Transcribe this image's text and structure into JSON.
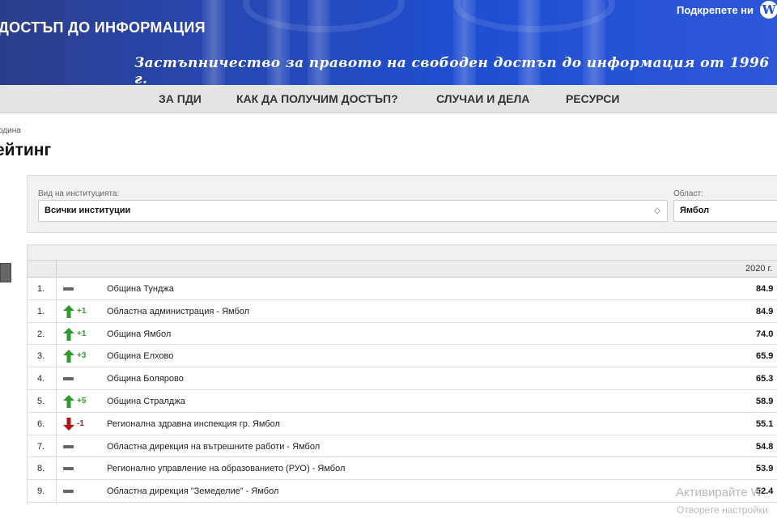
{
  "header": {
    "site_title": "ДОСТЪП ДО ИНФОРМАЦИЯ",
    "tagline": "Застъпничество за правото на свободен достъп до информация от 1996 г.",
    "support_link": "Подкрепете ни",
    "wordpress_icon": "wordpress-icon",
    "wordpress_glyph": "W"
  },
  "nav": {
    "items": [
      {
        "label": "ЗА ПДИ"
      },
      {
        "label": "КАК ДА ПОЛУЧИМ ДОСТЪП?"
      },
      {
        "label": "СЛУЧАИ И ДЕЛА"
      },
      {
        "label": "РЕСУРСИ"
      }
    ]
  },
  "breadcrumb": "одина",
  "page_title": "ейтинг",
  "filters": {
    "institution_type": {
      "label": "Вид на институцията:",
      "value": "Всички институции",
      "chevron": "◇"
    },
    "region": {
      "label": "Област:",
      "value": "Ямбол"
    }
  },
  "table": {
    "year_header": "2020 г.",
    "rows": [
      {
        "rank": "1.",
        "trend": "flat",
        "change": "",
        "name": "Община Тунджа",
        "score": "84.9"
      },
      {
        "rank": "1.",
        "trend": "up",
        "change": "+1",
        "name": "Областна администрация - Ямбол",
        "score": "84.9"
      },
      {
        "rank": "2.",
        "trend": "up",
        "change": "+1",
        "name": "Община Ямбол",
        "score": "74.0"
      },
      {
        "rank": "3.",
        "trend": "up",
        "change": "+3",
        "name": "Община Елхово",
        "score": "65.9"
      },
      {
        "rank": "4.",
        "trend": "flat",
        "change": "",
        "name": "Община Болярово",
        "score": "65.3"
      },
      {
        "rank": "5.",
        "trend": "up",
        "change": "+5",
        "name": "Община Стралджа",
        "score": "58.9"
      },
      {
        "rank": "6.",
        "trend": "down",
        "change": "-1",
        "name": "Регионална здравна инспекция гр. Ямбол",
        "score": "55.1"
      },
      {
        "rank": "7.",
        "trend": "flat",
        "change": "",
        "name": "Областна дирекция на вътрешните работи - Ямбол",
        "score": "54.8"
      },
      {
        "rank": "8.",
        "trend": "flat",
        "change": "",
        "name": "Регионално управление на образованието (РУО) - Ямбол",
        "score": "53.9"
      },
      {
        "rank": "9.",
        "trend": "flat",
        "change": "",
        "name": "Областна дирекция \"Земеделие\" - Ямбол",
        "score": "52.4"
      }
    ]
  },
  "colors": {
    "trend_up": "#2e9b2e",
    "trend_down": "#b01818",
    "trend_flat": "#666666",
    "header_blue": "#1f4fd0"
  },
  "watermark": {
    "line1": "Активирайте W",
    "line2": "Отворете настройки"
  }
}
